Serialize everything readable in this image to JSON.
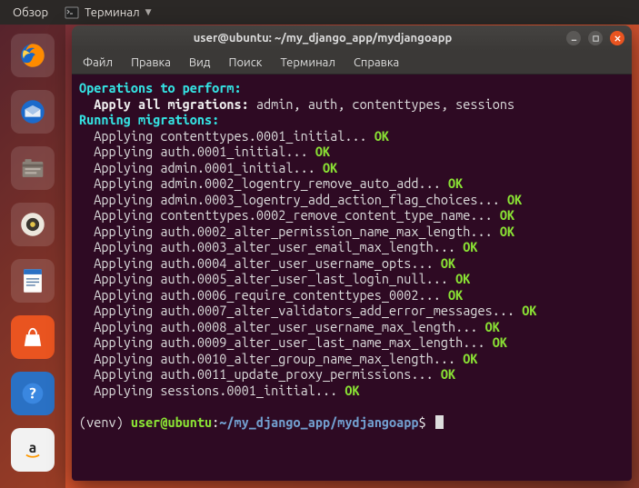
{
  "topbar": {
    "overview": "Обзор",
    "app_label": "Терминал"
  },
  "launcher": {
    "items": [
      "firefox",
      "thunderbird",
      "files",
      "rhythmbox",
      "writer",
      "software",
      "help",
      "amazon"
    ]
  },
  "window": {
    "title": "user@ubuntu: ~/my_django_app/mydjangoapp",
    "menu": [
      "Файл",
      "Правка",
      "Вид",
      "Поиск",
      "Терминал",
      "Справка"
    ],
    "controls": [
      "minimize",
      "maximize",
      "close"
    ]
  },
  "terminal": {
    "heading_ops": "Operations to perform:",
    "apply_label": "  Apply all migrations:",
    "apply_list": " admin, auth, contenttypes, sessions",
    "heading_run": "Running migrations:",
    "indent": "  ",
    "applying_prefix": "Applying ",
    "ellipsis": "... ",
    "ok": "OK",
    "migrations": [
      "contenttypes.0001_initial",
      "auth.0001_initial",
      "admin.0001_initial",
      "admin.0002_logentry_remove_auto_add",
      "admin.0003_logentry_add_action_flag_choices",
      "contenttypes.0002_remove_content_type_name",
      "auth.0002_alter_permission_name_max_length",
      "auth.0003_alter_user_email_max_length",
      "auth.0004_alter_user_username_opts",
      "auth.0005_alter_user_last_login_null",
      "auth.0006_require_contenttypes_0002",
      "auth.0007_alter_validators_add_error_messages",
      "auth.0008_alter_user_username_max_length",
      "auth.0009_alter_user_last_name_max_length",
      "auth.0010_alter_group_name_max_length",
      "auth.0011_update_proxy_permissions",
      "sessions.0001_initial"
    ],
    "prompt": {
      "venv": "(venv) ",
      "userhost": "user@ubuntu",
      "colon": ":",
      "path": "~/my_django_app/mydjangoapp",
      "dollar": "$ "
    }
  }
}
